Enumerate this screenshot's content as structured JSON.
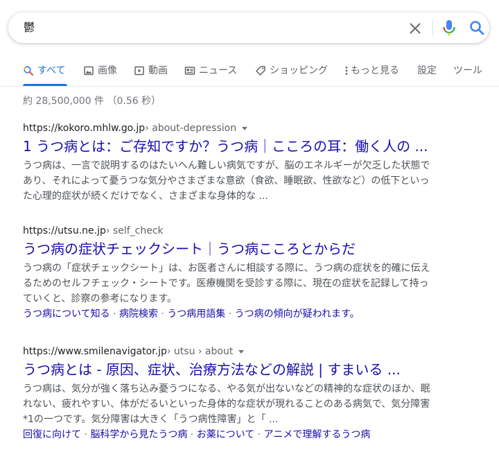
{
  "search": {
    "query": "鬱"
  },
  "tabs": [
    {
      "label": "すべて",
      "icon": "search-icon"
    },
    {
      "label": "画像",
      "icon": "image-icon"
    },
    {
      "label": "動画",
      "icon": "play-icon"
    },
    {
      "label": "ニュース",
      "icon": "news-icon"
    },
    {
      "label": "ショッピング",
      "icon": "tag-icon"
    },
    {
      "label": "もっと見る",
      "icon": "more-vert-icon"
    },
    {
      "label": "設定"
    },
    {
      "label": "ツール"
    }
  ],
  "stats": "約 28,500,000 件 （0.56 秒）",
  "results": [
    {
      "domain": "https://kokoro.mhlw.go.jp",
      "path": " › about-depression",
      "title": "1 うつ病とは：ご存知ですか？うつ病｜こころの耳：働く人の ...",
      "snippet": "うつ病は、一言で説明するのはたいへん難しい病気ですが、脳のエネルギーが欠乏した状態であり、それによって憂うつな気分やさまざまな意欲（食欲、睡眠欲、性欲など）の低下といった心理的症状が続くだけでなく、さまざまな身体的な ..."
    },
    {
      "domain": "https://utsu.ne.jp",
      "path": " › self_check",
      "title": "うつ病の症状チェックシート｜うつ病こころとからだ",
      "snippet": "うつ病の「症状チェックシート」は、お医者さんに相談する際に、うつ病の症状を的確に伝えるためのセルフチェック・シートです。医療機関を受診する際に、現在の症状を記録して持っていくと、診察の参考になります。",
      "sitelinks": [
        "うつ病について知る",
        "病院検索",
        "うつ病用語集",
        "うつ病の傾向が疑われます。"
      ]
    },
    {
      "domain": "https://www.smilenavigator.jp",
      "path": " › utsu › about",
      "title": "うつ病とは - 原因、症状、治療方法などの解説 | すまいる ...",
      "snippet": "うつ病は、気分が強く落ち込み憂うつになる、やる気が出ないなどの精神的な症状のほか、眠れない、疲れやすい、体がだるいといった身体的な症状が現れることのある病気で、気分障害*1の一つです。気分障害は大きく「うつ病性障害」と「 ...",
      "sitelinks": [
        "回復に向けて",
        "脳科学から見たうつ病",
        "お薬について",
        "アニメで理解するうつ病"
      ]
    }
  ],
  "sitelink_separator": " · ",
  "colors": {
    "link": "#1a0dab",
    "accent": "#1a73e8",
    "snippet": "#4d5156",
    "muted": "#70757a"
  }
}
